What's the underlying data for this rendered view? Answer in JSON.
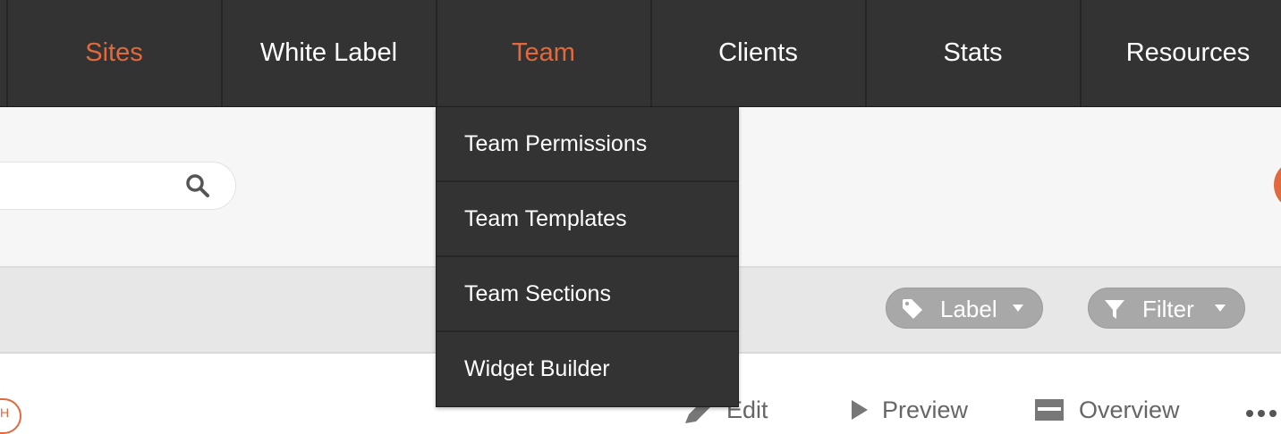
{
  "nav": {
    "items": [
      {
        "label": "Sites"
      },
      {
        "label": "White Label"
      },
      {
        "label": "Team"
      },
      {
        "label": "Clients"
      },
      {
        "label": "Stats"
      },
      {
        "label": "Resources"
      }
    ],
    "highlighted": [
      "Sites",
      "Team"
    ]
  },
  "dropdown": {
    "parent": "Team",
    "items": [
      {
        "label": "Team Permissions"
      },
      {
        "label": "Team Templates"
      },
      {
        "label": "Team Sections"
      },
      {
        "label": "Widget Builder"
      }
    ]
  },
  "search": {
    "value": "",
    "icon": "search-icon"
  },
  "toolbar": {
    "label_button": "Label",
    "filter_button": "Filter"
  },
  "site_actions": {
    "status_text": "H",
    "edit": "Edit",
    "preview": "Preview",
    "overview": "Overview"
  },
  "colors": {
    "accent": "#e0693d",
    "nav_background": "#333333",
    "search_band": "#f6f6f6",
    "filter_band": "#e7e7e7",
    "pill": "#a8a8a8"
  }
}
